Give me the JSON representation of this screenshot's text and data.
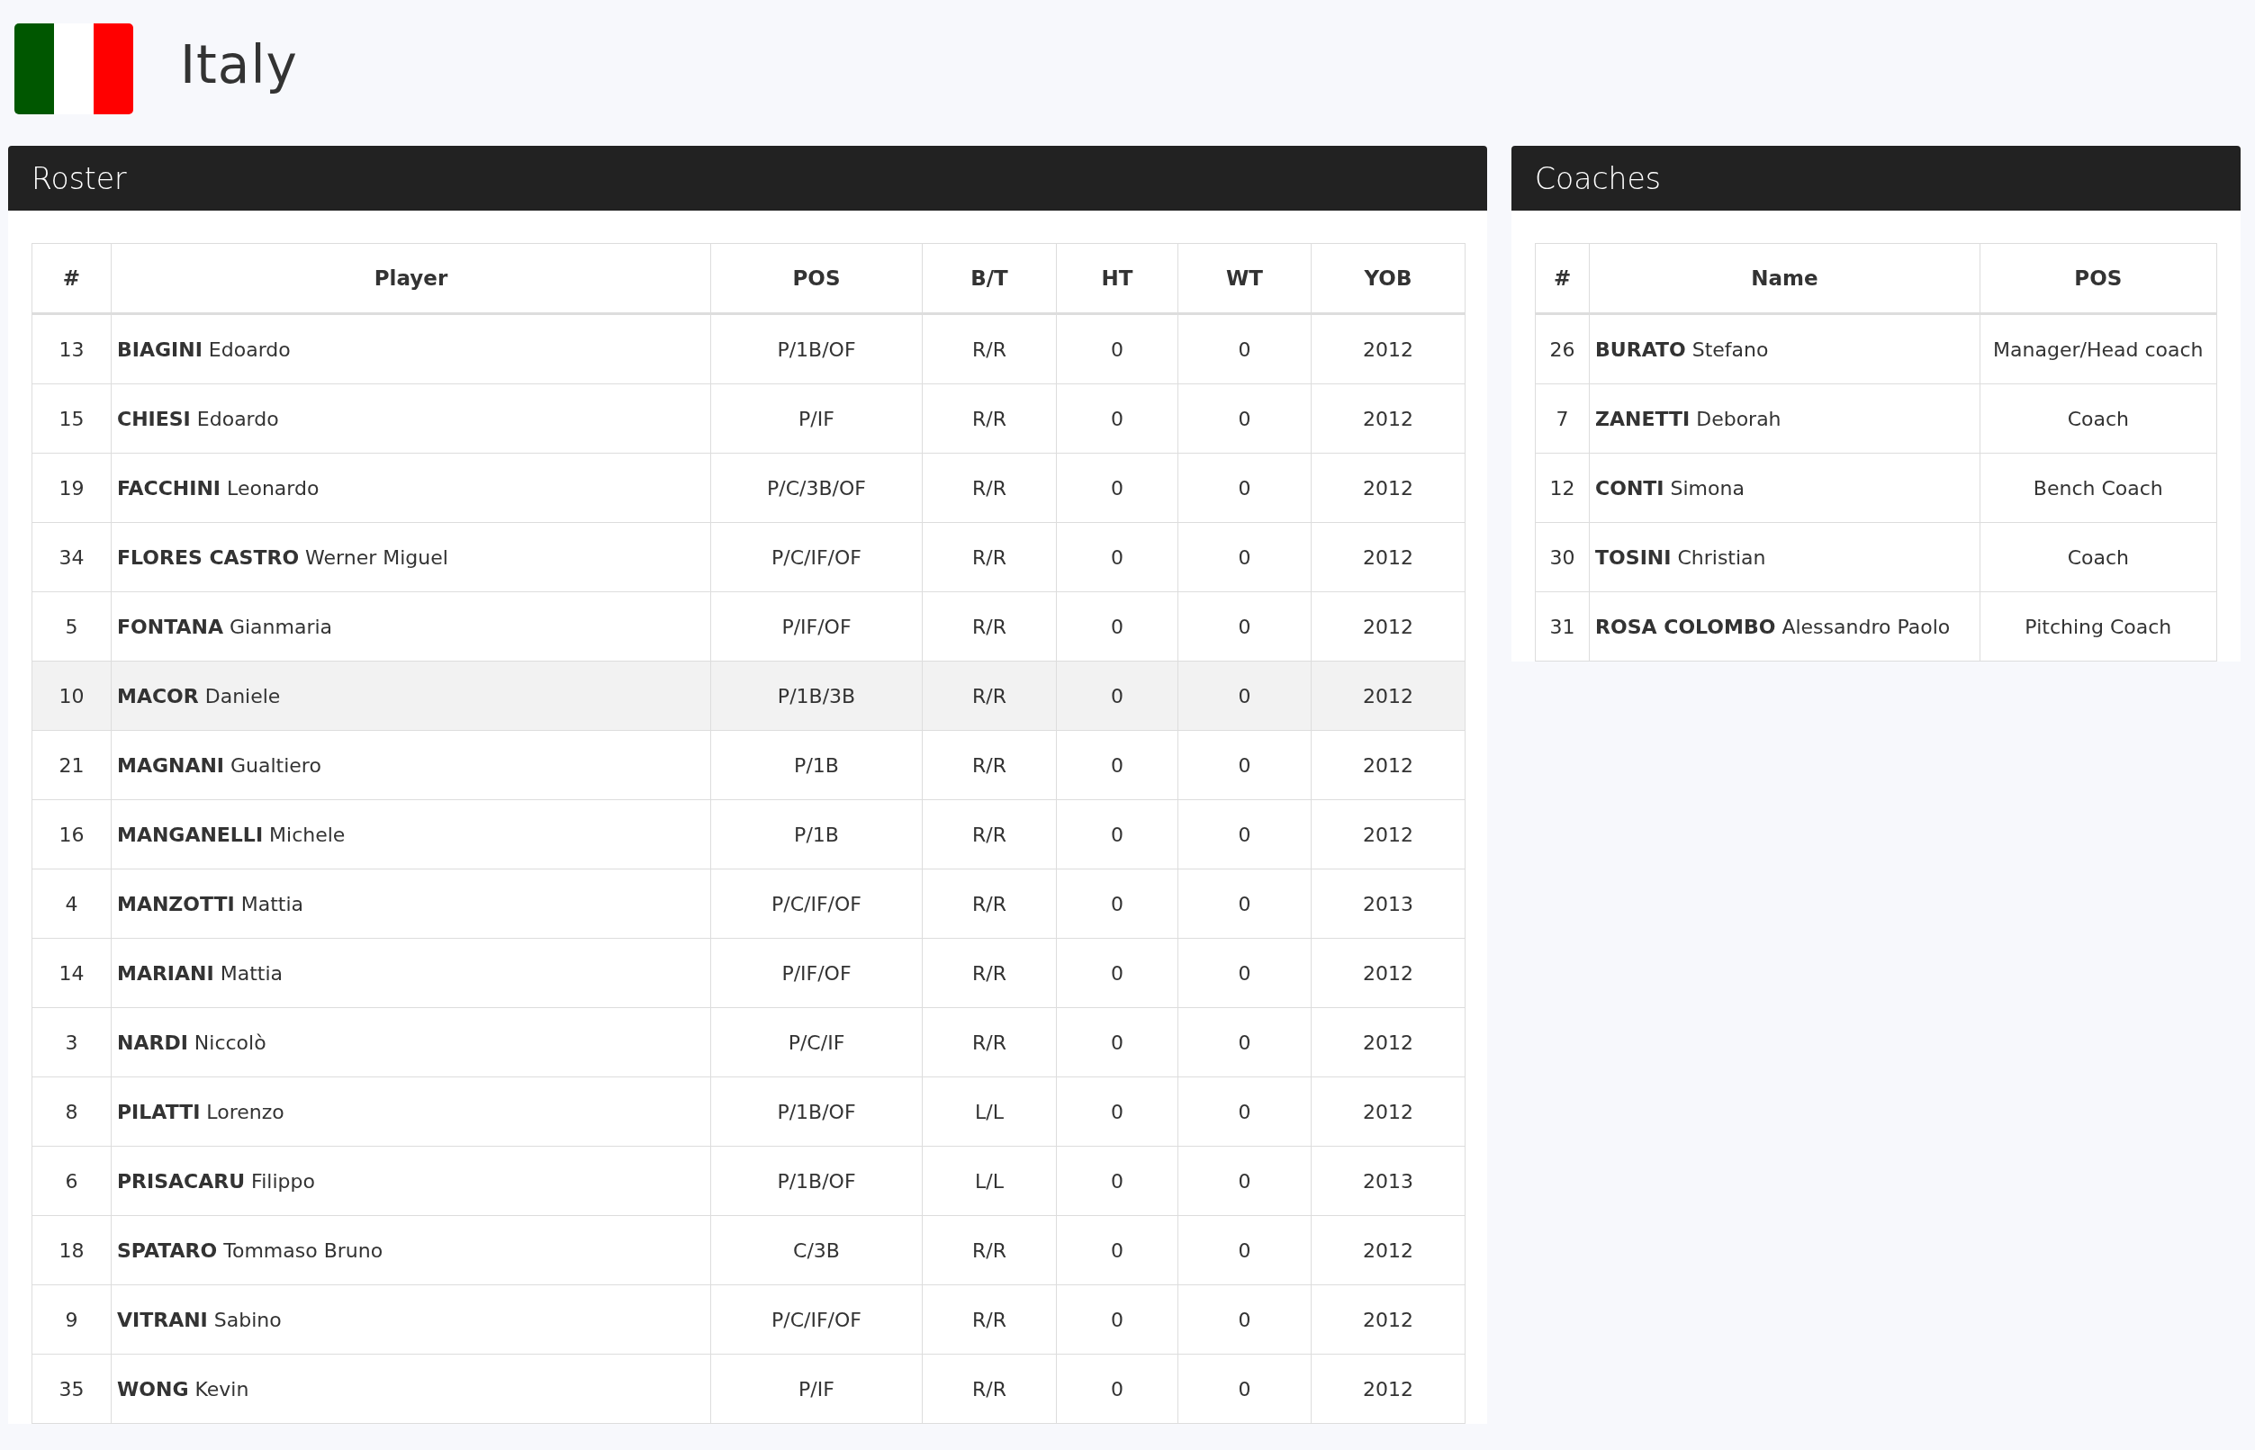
{
  "header": {
    "title": "Italy"
  },
  "roster": {
    "title": "Roster",
    "columns": [
      "#",
      "Player",
      "POS",
      "B/T",
      "HT",
      "WT",
      "YOB"
    ],
    "rows": [
      {
        "number": "13",
        "player": "**BIAGINI** Edoardo",
        "pos": "P/1B/OF",
        "bt": "R/R",
        "ht": "0",
        "wt": "0",
        "yob": "2012",
        "highlighted": false
      },
      {
        "number": "15",
        "player": "**CHIESI** Edoardo",
        "pos": "P/IF",
        "bt": "R/R",
        "ht": "0",
        "wt": "0",
        "yob": "2012",
        "highlighted": false
      },
      {
        "number": "19",
        "player": "**FACCHINI** Leonardo",
        "pos": "P/C/3B/OF",
        "bt": "R/R",
        "ht": "0",
        "wt": "0",
        "yob": "2012",
        "highlighted": false
      },
      {
        "number": "34",
        "player": "**FLORES CASTRO** Werner Miguel",
        "pos": "P/C/IF/OF",
        "bt": "R/R",
        "ht": "0",
        "wt": "0",
        "yob": "2012",
        "highlighted": false
      },
      {
        "number": "5",
        "player": "**FONTANA** Gianmaria",
        "pos": "P/IF/OF",
        "bt": "R/R",
        "ht": "0",
        "wt": "0",
        "yob": "2012",
        "highlighted": false
      },
      {
        "number": "10",
        "player": "**MACOR** Daniele",
        "pos": "P/1B/3B",
        "bt": "R/R",
        "ht": "0",
        "wt": "0",
        "yob": "2012",
        "highlighted": true
      },
      {
        "number": "21",
        "player": "**MAGNANI** Gualtiero",
        "pos": "P/1B",
        "bt": "R/R",
        "ht": "0",
        "wt": "0",
        "yob": "2012",
        "highlighted": false
      },
      {
        "number": "16",
        "player": "**MANGANELLI** Michele",
        "pos": "P/1B",
        "bt": "R/R",
        "ht": "0",
        "wt": "0",
        "yob": "2012",
        "highlighted": false
      },
      {
        "number": "4",
        "player": "**MANZOTTI** Mattia",
        "pos": "P/C/IF/OF",
        "bt": "R/R",
        "ht": "0",
        "wt": "0",
        "yob": "2013",
        "highlighted": false
      },
      {
        "number": "14",
        "player": "**MARIANI** Mattia",
        "pos": "P/IF/OF",
        "bt": "R/R",
        "ht": "0",
        "wt": "0",
        "yob": "2012",
        "highlighted": false
      },
      {
        "number": "3",
        "player": "**NARDI** Niccolò",
        "pos": "P/C/IF",
        "bt": "R/R",
        "ht": "0",
        "wt": "0",
        "yob": "2012",
        "highlighted": false
      },
      {
        "number": "8",
        "player": "**PILATTI** Lorenzo",
        "pos": "P/1B/OF",
        "bt": "L/L",
        "ht": "0",
        "wt": "0",
        "yob": "2012",
        "highlighted": false
      },
      {
        "number": "6",
        "player": "**PRISACARU** Filippo",
        "pos": "P/1B/OF",
        "bt": "L/L",
        "ht": "0",
        "wt": "0",
        "yob": "2013",
        "highlighted": false
      },
      {
        "number": "18",
        "player": "**SPATARO** Tommaso Bruno",
        "pos": "C/3B",
        "bt": "R/R",
        "ht": "0",
        "wt": "0",
        "yob": "2012",
        "highlighted": false
      },
      {
        "number": "9",
        "player": "**VITRANI** Sabino",
        "pos": "P/C/IF/OF",
        "bt": "R/R",
        "ht": "0",
        "wt": "0",
        "yob": "2012",
        "highlighted": false
      },
      {
        "number": "35",
        "player": "**WONG** Kevin",
        "pos": "P/IF",
        "bt": "R/R",
        "ht": "0",
        "wt": "0",
        "yob": "2012",
        "highlighted": false
      }
    ]
  },
  "coaches": {
    "title": "Coaches",
    "columns": [
      "#",
      "Name",
      "POS"
    ],
    "rows": [
      {
        "number": "26",
        "name": "**BURATO** Stefano",
        "pos": "Manager/Head coach"
      },
      {
        "number": "7",
        "name": "**ZANETTI** Deborah",
        "pos": "Coach"
      },
      {
        "number": "12",
        "name": "**CONTI** Simona",
        "pos": "Bench Coach"
      },
      {
        "number": "30",
        "name": "**TOSINI** Christian",
        "pos": "Coach"
      },
      {
        "number": "31",
        "name": "**ROSA COLOMBO** Alessandro Paolo",
        "pos": "Pitching Coach"
      }
    ]
  }
}
